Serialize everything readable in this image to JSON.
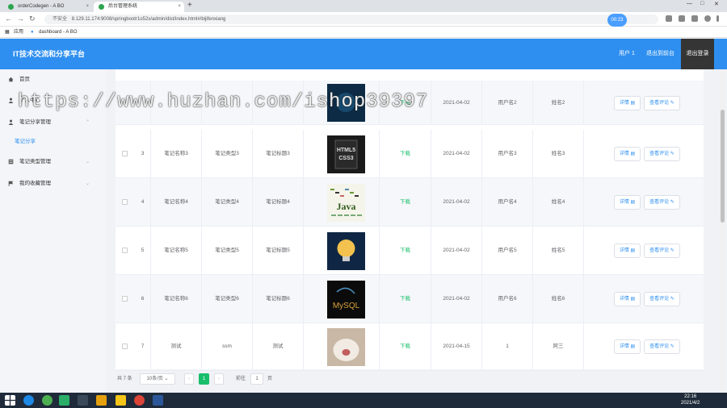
{
  "browser": {
    "tabs": [
      {
        "label": "orderCodegen - A BO"
      },
      {
        "label": "后台管理系统"
      }
    ],
    "url": "8.129.11.174:9008/springbootr1o52x/admin/dist/index.html#/bijifenxiang",
    "insecure_label": "不安全",
    "bookmarks": [
      {
        "label": "应用"
      },
      {
        "label": "dashboard - A BO"
      }
    ],
    "time_badge": "00:23"
  },
  "header": {
    "brand": "IT技术交流和分享平台",
    "user": "用户 1",
    "back_to_front": "退出到前台",
    "logout": "退出登录"
  },
  "sidebar": {
    "items": [
      {
        "label": "首页"
      },
      {
        "label": "个人中心"
      },
      {
        "label": "笔记分享管理"
      },
      {
        "label": "笔记分享"
      },
      {
        "label": "笔记类型管理"
      },
      {
        "label": "我的收藏管理"
      }
    ]
  },
  "table": {
    "download_label": "下载",
    "detail_label": "详情",
    "comment_label": "查看评论",
    "rows": [
      {
        "idx": "",
        "name": "",
        "type": "",
        "title": "",
        "img": "dark",
        "date": "2021-04-02",
        "user": "用户名2",
        "real": "姓名2"
      },
      {
        "idx": "3",
        "name": "笔记名称3",
        "type": "笔记类型3",
        "title": "笔记标题3",
        "img": "html5",
        "date": "2021-04-02",
        "user": "用户名3",
        "real": "姓名3"
      },
      {
        "idx": "4",
        "name": "笔记名称4",
        "type": "笔记类型4",
        "title": "笔记标题4",
        "img": "java",
        "date": "2021-04-02",
        "user": "用户名4",
        "real": "姓名4"
      },
      {
        "idx": "5",
        "name": "笔记名称5",
        "type": "笔记类型5",
        "title": "笔记标题5",
        "img": "bulb",
        "date": "2021-04-02",
        "user": "用户名5",
        "real": "姓名5"
      },
      {
        "idx": "6",
        "name": "笔记名称6",
        "type": "笔记类型6",
        "title": "笔记标题6",
        "img": "mysql",
        "date": "2021-04-02",
        "user": "用户名6",
        "real": "姓名6"
      },
      {
        "idx": "7",
        "name": "测试",
        "type": "ssm",
        "title": "测试",
        "img": "cat",
        "date": "2021-04-15",
        "user": "1",
        "real": "阿三"
      }
    ]
  },
  "pager": {
    "total": "共 7 条",
    "page_size": "10条/页",
    "current": "1",
    "goto_label": "前往",
    "goto_value": "1",
    "page_unit": "页"
  },
  "thumb_text": {
    "html5": "HTML5\nCSS3",
    "java": "Java",
    "mysql": "MySQL"
  },
  "watermark": "https://www.huzhan.com/ishop39397",
  "taskbar": {
    "time": "22:16",
    "date": "2021/4/2"
  }
}
